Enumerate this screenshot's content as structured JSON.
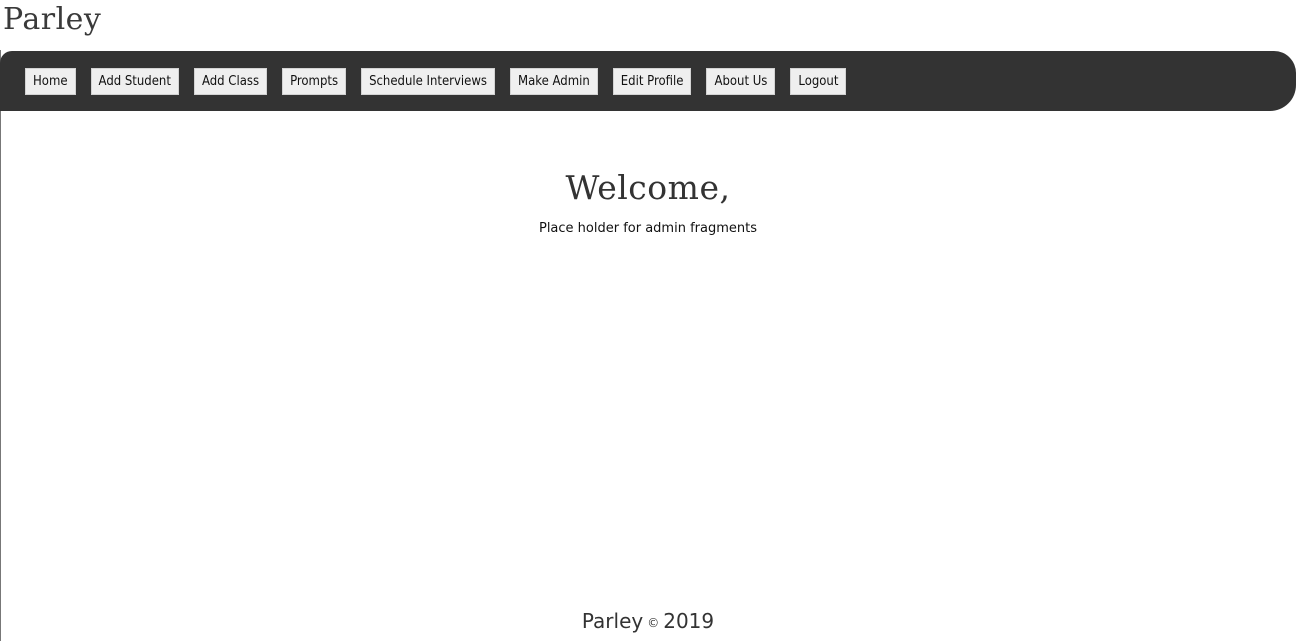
{
  "header": {
    "brand": "Parley"
  },
  "nav": {
    "items": [
      {
        "label": "Home",
        "name": "nav-home-button"
      },
      {
        "label": "Add Student",
        "name": "nav-add-student-button"
      },
      {
        "label": "Add Class",
        "name": "nav-add-class-button"
      },
      {
        "label": "Prompts",
        "name": "nav-prompts-button"
      },
      {
        "label": "Schedule Interviews",
        "name": "nav-schedule-interviews-button"
      },
      {
        "label": "Make Admin",
        "name": "nav-make-admin-button"
      },
      {
        "label": "Edit Profile",
        "name": "nav-edit-profile-button"
      },
      {
        "label": "About Us",
        "name": "nav-about-us-button"
      },
      {
        "label": "Logout",
        "name": "nav-logout-button"
      }
    ]
  },
  "main": {
    "welcome": "Welcome,",
    "placeholder": "Place holder for admin fragments"
  },
  "footer": {
    "brand": "Parley",
    "copyright_symbol": "©",
    "year": "2019"
  },
  "colors": {
    "navbar_bg": "#333333",
    "button_bg": "#efefef",
    "page_bg": "#ffffff"
  }
}
